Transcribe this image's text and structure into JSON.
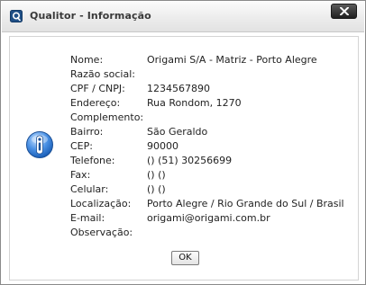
{
  "window": {
    "title": "Qualitor - Informação",
    "close_icon": "close-icon",
    "app_icon": "qualitor-app-icon"
  },
  "info_icon": "info-icon",
  "fields": [
    {
      "label": "Nome:",
      "value": "Origami S/A - Matriz - Porto Alegre"
    },
    {
      "label": "Razão social:",
      "value": ""
    },
    {
      "label": "CPF / CNPJ:",
      "value": "1234567890"
    },
    {
      "label": "Endereço:",
      "value": "Rua Rondom, 1270"
    },
    {
      "label": "Complemento:",
      "value": ""
    },
    {
      "label": "Bairro:",
      "value": "São Geraldo"
    },
    {
      "label": "CEP:",
      "value": "90000"
    },
    {
      "label": "Telefone:",
      "value": "() (51) 30256699"
    },
    {
      "label": "Fax:",
      "value": "() ()"
    },
    {
      "label": "Celular:",
      "value": "() ()"
    },
    {
      "label": "Localização:",
      "value": "Porto Alegre / Rio Grande do Sul / Brasil"
    },
    {
      "label": "E-mail:",
      "value": "origami@origami.com.br"
    },
    {
      "label": "Observação:",
      "value": ""
    }
  ],
  "ok_label": "OK"
}
